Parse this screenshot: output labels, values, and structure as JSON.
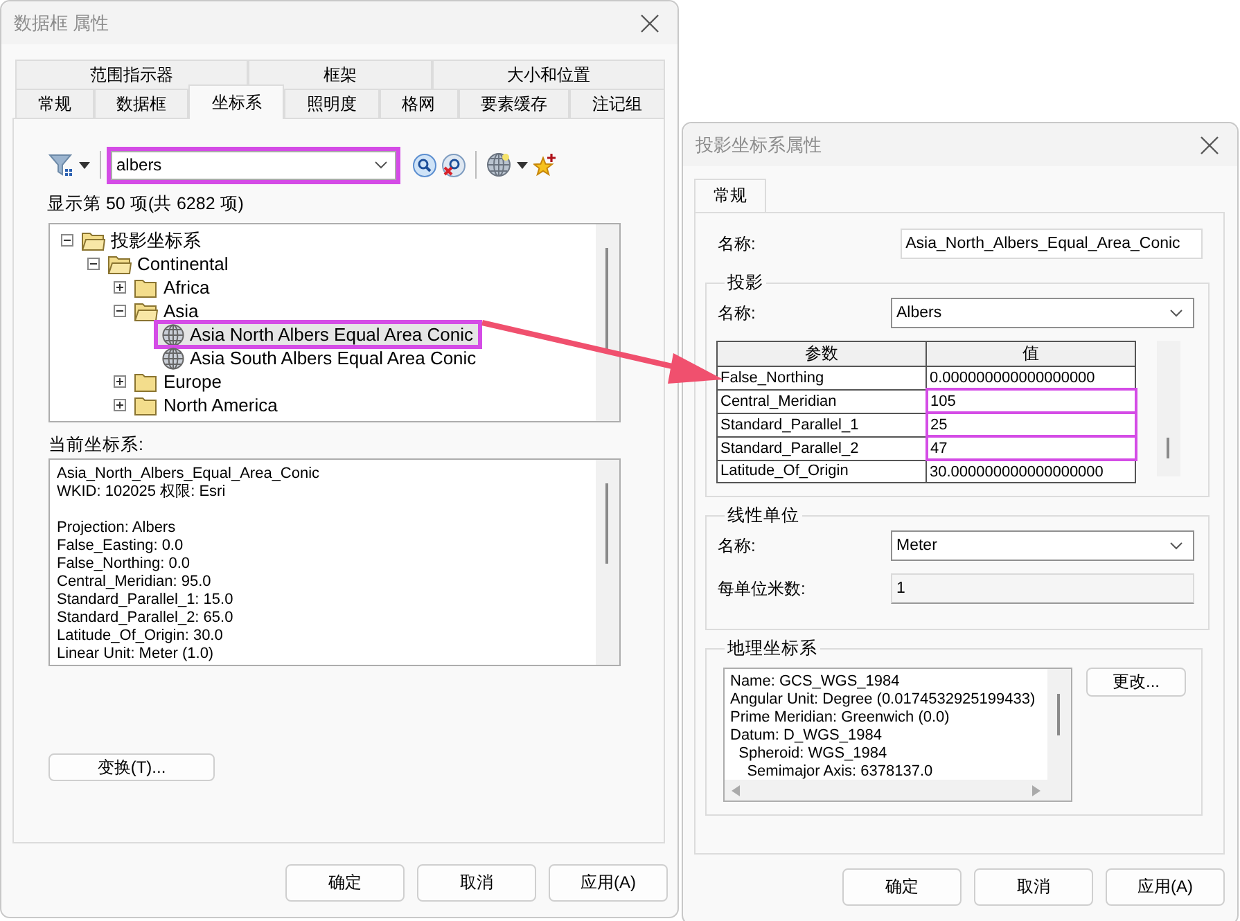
{
  "left_window": {
    "title": "数据框 属性",
    "tab_rows": [
      [
        {
          "label": "范围指示器",
          "selected": false
        },
        {
          "label": "框架",
          "selected": false
        },
        {
          "label": "大小和位置",
          "selected": false
        }
      ],
      [
        {
          "label": "常规",
          "selected": false
        },
        {
          "label": "数据框",
          "selected": false
        },
        {
          "label": "坐标系",
          "selected": true
        },
        {
          "label": "照明度",
          "selected": false
        },
        {
          "label": "格网",
          "selected": false
        },
        {
          "label": "要素缓存",
          "selected": false
        },
        {
          "label": "注记组",
          "selected": false
        }
      ]
    ],
    "search": {
      "value": "albers",
      "highlighted": true
    },
    "count_label": "显示第 50 项(共 6282 项)",
    "tree": [
      {
        "label": "投影坐标系",
        "kind": "folder",
        "expanded": true,
        "children": [
          {
            "label": "Continental",
            "kind": "folder",
            "expanded": true,
            "children": [
              {
                "label": "Africa",
                "kind": "folder",
                "expanded": false
              },
              {
                "label": "Asia",
                "kind": "folder",
                "expanded": true,
                "children": [
                  {
                    "label": "Asia North Albers Equal Area Conic",
                    "kind": "crs",
                    "selected": true
                  },
                  {
                    "label": "Asia South Albers Equal Area Conic",
                    "kind": "crs",
                    "selected": false
                  }
                ]
              },
              {
                "label": "Europe",
                "kind": "folder",
                "expanded": false
              },
              {
                "label": "North America",
                "kind": "folder",
                "expanded": false
              }
            ]
          }
        ]
      }
    ],
    "current_label": "当前坐标系:",
    "current_blocks": [
      [
        "Asia_North_Albers_Equal_Area_Conic",
        "WKID: 102025 权限: Esri"
      ],
      [
        "Projection: Albers",
        "False_Easting: 0.0",
        "False_Northing: 0.0",
        "Central_Meridian: 95.0",
        "Standard_Parallel_1: 15.0",
        "Standard_Parallel_2: 65.0",
        "Latitude_Of_Origin: 30.0",
        "Linear Unit: Meter (1.0)"
      ]
    ],
    "transform_button": "变换(T)...",
    "buttons": [
      "确定",
      "取消",
      "应用(A)"
    ]
  },
  "right_window": {
    "title": "投影坐标系属性",
    "tabs": [
      {
        "label": "常规",
        "selected": true
      }
    ],
    "name_label": "名称:",
    "name_value": "Asia_North_Albers_Equal_Area_Conic",
    "projection": {
      "legend": "投影",
      "name_label": "名称:",
      "name_value": "Albers",
      "columns": [
        "参数",
        "值"
      ],
      "rows": [
        {
          "param": "False_Northing",
          "value": "0.000000000000000000",
          "highlighted": false
        },
        {
          "param": "Central_Meridian",
          "value": "105",
          "highlighted": true
        },
        {
          "param": "Standard_Parallel_1",
          "value": "25",
          "highlighted": true
        },
        {
          "param": "Standard_Parallel_2",
          "value": "47",
          "highlighted": true
        },
        {
          "param": "Latitude_Of_Origin",
          "value": "30.000000000000000000",
          "highlighted": false
        }
      ]
    },
    "linear_unit": {
      "legend": "线性单位",
      "name_label": "名称:",
      "name_value": "Meter",
      "meters_label": "每单位米数:",
      "meters_value": "1"
    },
    "geographic": {
      "legend": "地理坐标系",
      "lines": [
        "Name: GCS_WGS_1984",
        "Angular Unit: Degree (0.0174532925199433)",
        "Prime Meridian: Greenwich (0.0)",
        "Datum: D_WGS_1984",
        "  Spheroid: WGS_1984",
        "    Semimajor Axis: 6378137.0"
      ],
      "change_button": "更改..."
    },
    "buttons": [
      "确定",
      "取消",
      "应用(A)"
    ]
  }
}
